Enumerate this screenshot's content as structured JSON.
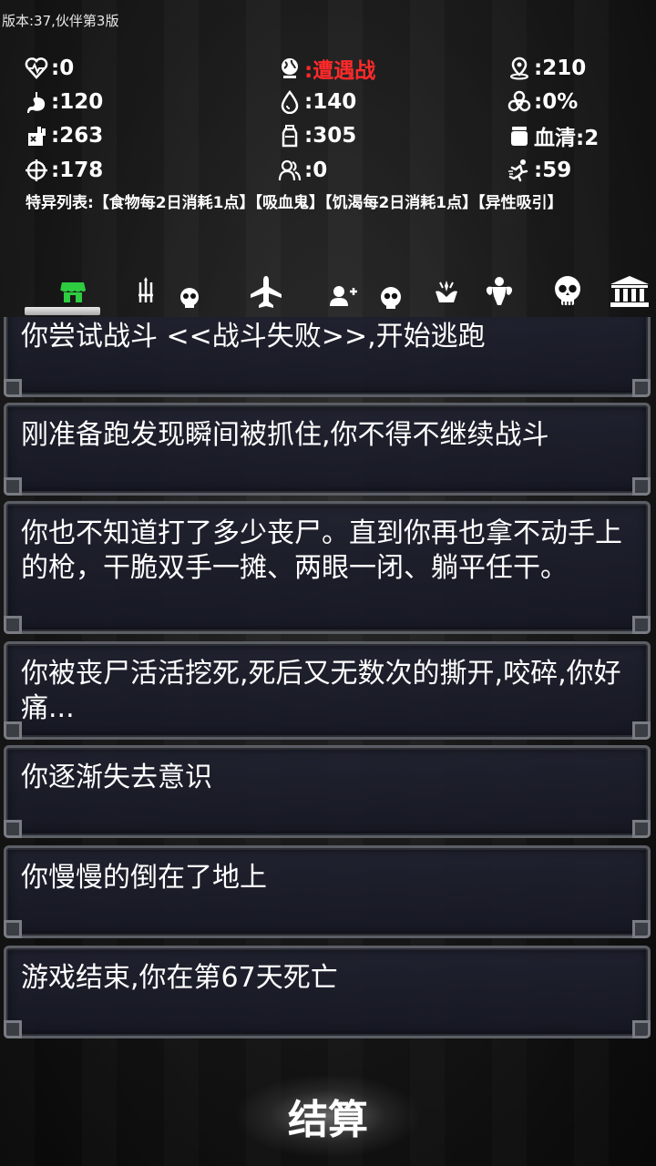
{
  "version": "版本:37,伙伴第3版",
  "stats": {
    "health": ":0",
    "event": ":遭遇战",
    "distance": ":210",
    "food": ":120",
    "water": ":140",
    "infection": ":0%",
    "ammo": ":263",
    "supplies": ":305",
    "serum": "血清:2",
    "accuracy": ":178",
    "companions": ":0",
    "speed": ":59"
  },
  "traits": "特异列表:【食物每2日消耗1点】【吸血鬼】【饥渴每2日消耗1点】【异性吸引】",
  "tabs": [
    {
      "icon": "shop-icon"
    },
    {
      "icon": "weapons-skull-icon"
    },
    {
      "icon": "plane-icon"
    },
    {
      "icon": "add-companion-skull-icon"
    },
    {
      "icon": "skills-icon"
    },
    {
      "icon": "strength-icon"
    },
    {
      "icon": "skull-icon"
    },
    {
      "icon": "bank-icon"
    }
  ],
  "log": [
    "你尝试战斗 <<战斗失败>>,开始逃跑",
    "刚准备跑发现瞬间被抓住,你不得不继续战斗",
    "你也不知道打了多少丧尸。直到你再也拿不动手上的枪，干脆双手一摊、两眼一闭、躺平任干。",
    "你被丧尸活活挖死,死后又无数次的撕开,咬碎,你好痛...",
    "你逐渐失去意识",
    "你慢慢的倒在了地上",
    "游戏结束,你在第67天死亡"
  ],
  "settle_label": "结算",
  "colors": {
    "event_red": "#ff2a2a",
    "shop_green": "#2ecc40"
  }
}
